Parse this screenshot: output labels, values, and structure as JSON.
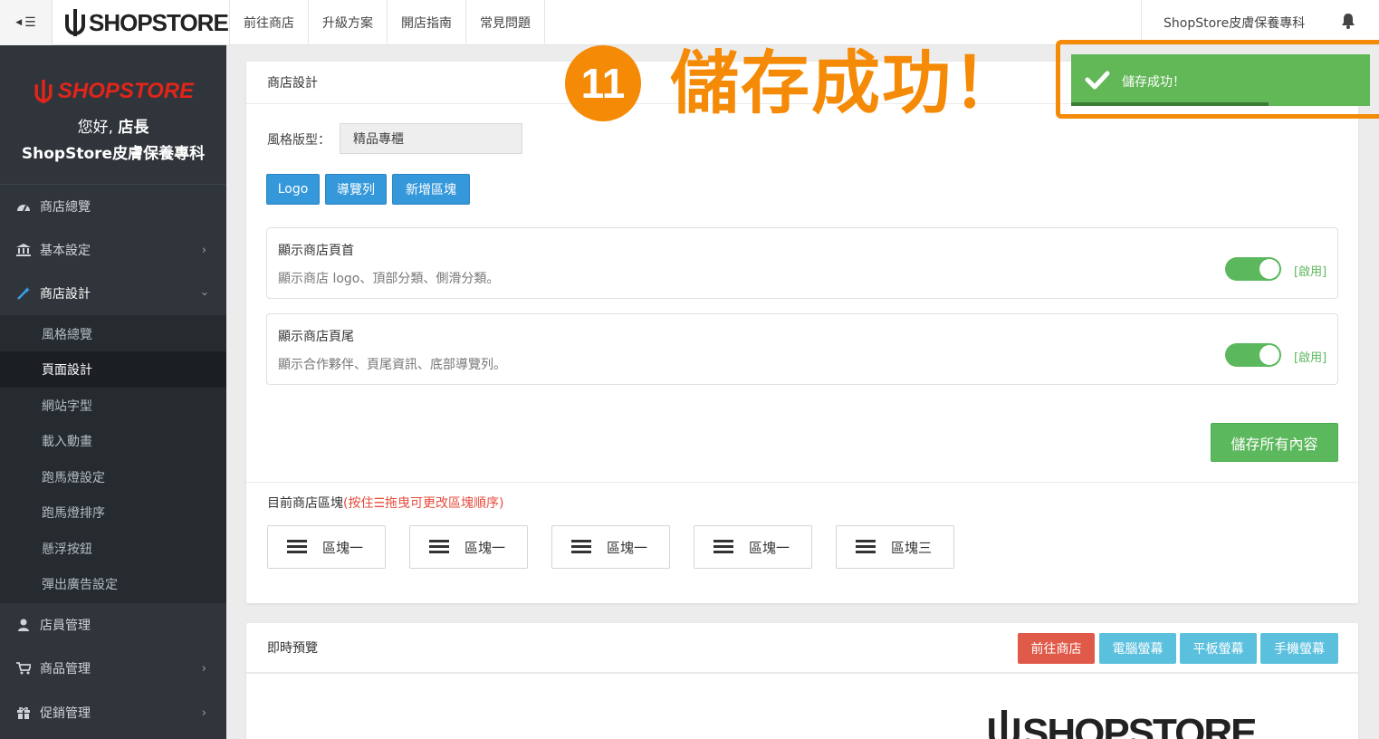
{
  "topbar": {
    "brand": "SHOPSTORE",
    "nav": [
      "前往商店",
      "升級方案",
      "開店指南",
      "常見問題"
    ],
    "store_name": "ShopStore皮膚保養專科"
  },
  "sidebar": {
    "logo_text": "SHOPSTORE",
    "greeting_prefix": "您好,",
    "greeting_name": "店長",
    "store_name": "ShopStore皮膚保養專科",
    "menu_top": [
      {
        "label": "商店總覽",
        "icon": "dashboard-icon"
      },
      {
        "label": "基本設定",
        "icon": "bank-icon"
      },
      {
        "label": "商店設計",
        "icon": "magic-wand-icon"
      }
    ],
    "submenu": [
      "風格總覽",
      "頁面設計",
      "網站字型",
      "載入動畫",
      "跑馬燈設定",
      "跑馬燈排序",
      "懸浮按鈕",
      "彈出廣告設定"
    ],
    "menu_bottom": [
      {
        "label": "店員管理",
        "icon": "staff-icon"
      },
      {
        "label": "商品管理",
        "icon": "cart-icon"
      },
      {
        "label": "促銷管理",
        "icon": "gift-icon"
      }
    ]
  },
  "design": {
    "title": "商店設計",
    "style_label": "風格版型：",
    "style_value": "精品專櫃",
    "buttons": [
      "Logo",
      "導覽列",
      "新增區塊"
    ],
    "header_card": {
      "title": "顯示商店頁首",
      "desc": "顯示商店 logo、頂部分類、側滑分類。",
      "status": "[啟用]"
    },
    "footer_card": {
      "title": "顯示商店頁尾",
      "desc": "顯示合作夥伴、頁尾資訊、底部導覽列。",
      "status": "[啟用]"
    },
    "save_all": "儲存所有內容",
    "blocks_title": "目前商店區塊",
    "blocks_hint": "(按住☰拖曳可更改區塊順序)",
    "blocks": [
      "區塊一",
      "區塊一",
      "區塊一",
      "區塊一",
      "區塊三"
    ]
  },
  "preview": {
    "title": "即時預覽",
    "buttons": [
      {
        "label": "前往商店",
        "color": "#e05a4a"
      },
      {
        "label": "電腦螢幕",
        "color": "#5bc0de"
      },
      {
        "label": "平板螢幕",
        "color": "#5bc0de"
      },
      {
        "label": "手機螢幕",
        "color": "#5bc0de"
      }
    ],
    "logo_text": "SHOPSTORE"
  },
  "annotation": {
    "step": "11",
    "text": "儲存成功！",
    "color": "#f58a07"
  },
  "toast": {
    "message": "儲存成功！",
    "color": "#62b756",
    "progress": 0.66
  }
}
